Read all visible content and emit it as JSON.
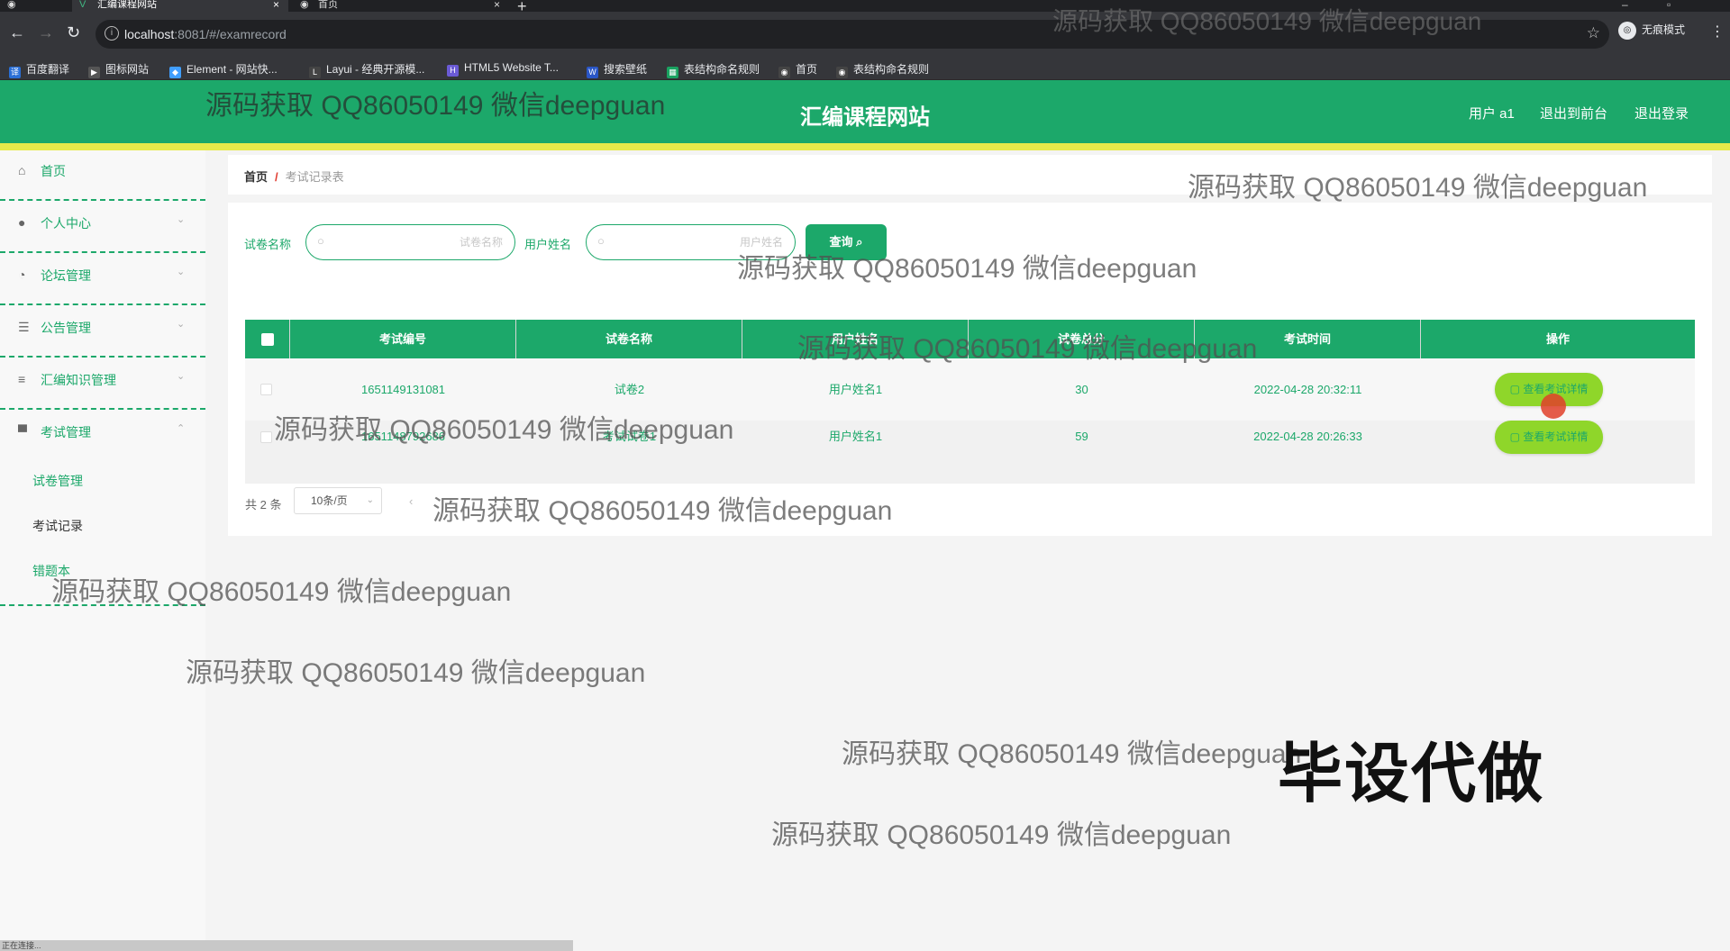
{
  "browser": {
    "tabs": [
      {
        "label": "汇编课程网站",
        "icon": "vue-icon"
      },
      {
        "label": "首页",
        "icon": "globe-icon"
      }
    ],
    "url_host": "localhost",
    "url_path": ":8081/#/examrecord",
    "incognito_label": "无痕模式",
    "bookmarks": [
      "百度翻译",
      "图标网站",
      "Element - 网站快...",
      "Layui - 经典开源模...",
      "HTML5 Website T...",
      "搜索壁纸",
      "表结构命名规则",
      "首页",
      "表结构命名规则"
    ]
  },
  "header": {
    "title": "汇编课程网站",
    "user": "用户 a1",
    "back_front": "退出到前台",
    "logout": "退出登录"
  },
  "sidebar": {
    "items": [
      {
        "label": "首页",
        "icon": "home-icon"
      },
      {
        "label": "个人中心",
        "icon": "user-icon"
      },
      {
        "label": "论坛管理",
        "icon": "forum-icon"
      },
      {
        "label": "公告管理",
        "icon": "notice-icon"
      },
      {
        "label": "汇编知识管理",
        "icon": "list-icon"
      },
      {
        "label": "考试管理",
        "icon": "exam-icon"
      }
    ],
    "sub_items": [
      "试卷管理",
      "考试记录",
      "错题本"
    ]
  },
  "breadcrumb": {
    "home": "首页",
    "sep": "/",
    "current": "考试记录表"
  },
  "search": {
    "paper_label": "试卷名称",
    "paper_placeholder": "试卷名称",
    "user_label": "用户姓名",
    "user_placeholder": "用户姓名",
    "query_label": "查询"
  },
  "table": {
    "headers": [
      "考试编号",
      "试卷名称",
      "用户姓名",
      "试卷总分",
      "考试时间",
      "操作"
    ],
    "rows": [
      {
        "id": "1651149131081",
        "paper": "试卷2",
        "user": "用户姓名1",
        "score": "30",
        "time": "2022-04-28 20:32:11",
        "action": "查看考试详情"
      },
      {
        "id": "1651148792686",
        "paper": "考试试卷1",
        "user": "用户姓名1",
        "score": "59",
        "time": "2022-04-28 20:26:33",
        "action": "查看考试详情"
      }
    ]
  },
  "pager": {
    "total": "共 2 条",
    "page_size": "10条/页"
  },
  "watermarks": {
    "text": "源码获取 QQ86050149 微信deepguan",
    "big": "毕设代做"
  },
  "status_bar": "正在连接..."
}
